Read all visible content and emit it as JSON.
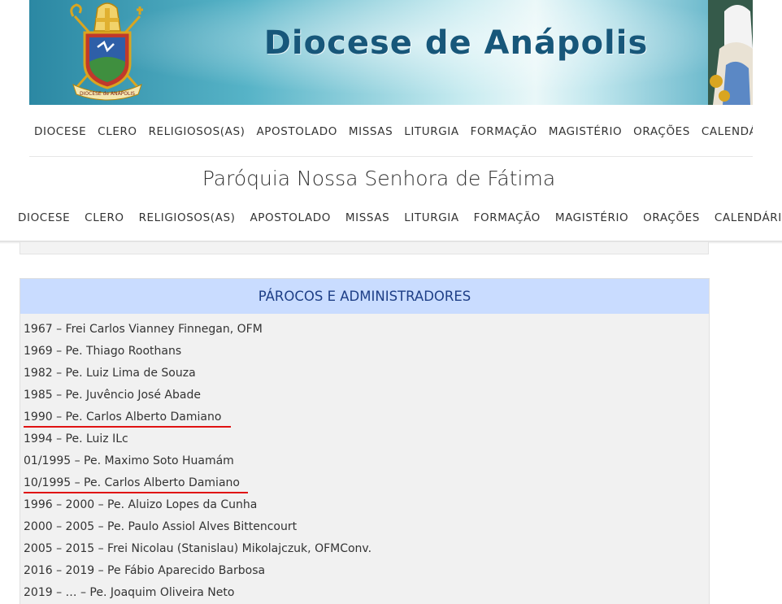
{
  "banner": {
    "title": "Diocese de Anápolis",
    "crest_text": "DIOCESE de ANÁPOLIS",
    "crest_icon": "episcopal-coat-of-arms",
    "statue_icon": "virgin-mary-statue"
  },
  "nav_top": [
    "DIOCESE",
    "CLERO",
    "RELIGIOSOS(AS)",
    "APOSTOLADO",
    "MISSAS",
    "LITURGIA",
    "FORMAÇÃO",
    "MAGISTÉRIO",
    "ORAÇÕES",
    "CALENDÁRIO"
  ],
  "parish": {
    "title": "Paróquia Nossa Senhora de Fátima"
  },
  "nav_sticky": [
    "DIOCESE",
    "CLERO",
    "RELIGIOSOS(AS)",
    "APOSTOLADO",
    "MISSAS",
    "LITURGIA",
    "FORMAÇÃO",
    "MAGISTÉRIO",
    "ORAÇÕES",
    "CALENDÁRIO"
  ],
  "parochos": {
    "heading": "PÁROCOS E ADMINISTRADORES",
    "items": [
      {
        "text": "1967 – Frei Carlos Vianney Finnegan, OFM",
        "underlined": false
      },
      {
        "text": "1969 – Pe. Thiago Roothans",
        "underlined": false
      },
      {
        "text": "1982 – Pe. Luiz Lima de Souza",
        "underlined": false
      },
      {
        "text": "1985 – Pe. Juvêncio José Abade",
        "underlined": false
      },
      {
        "text": "1990 – Pe. Carlos Alberto Damiano",
        "underlined": true
      },
      {
        "text": "1994 – Pe. Luiz ILc",
        "underlined": false
      },
      {
        "text": "01/1995 – Pe. Maximo Soto Huamám",
        "underlined": false
      },
      {
        "text": "10/1995 – Pe. Carlos Alberto Damiano",
        "underlined": true
      },
      {
        "text": "1996 – 2000 – Pe. Aluizo Lopes da Cunha",
        "underlined": false
      },
      {
        "text": "2000 – 2005 – Pe. Paulo Assiol Alves Bittencourt",
        "underlined": false
      },
      {
        "text": "2005 – 2015 – Frei Nicolau (Stanislau) Mikolajczuk, OFMConv.",
        "underlined": false
      },
      {
        "text": "2016 – 2019 – Pe Fábio Aparecido Barbosa",
        "underlined": false
      },
      {
        "text": "2019 – … – Pe. Joaquim Oliveira Neto",
        "underlined": false
      }
    ]
  },
  "colors": {
    "heading_bg": "#c9dcff",
    "heading_text": "#1e3f87",
    "annotation_underline": "#e01212",
    "banner_title": "#17577a"
  }
}
